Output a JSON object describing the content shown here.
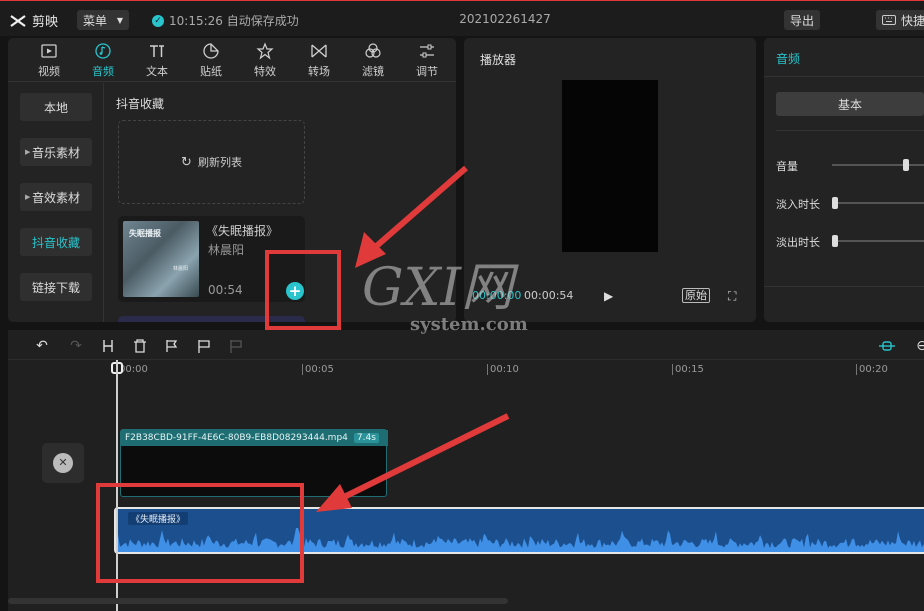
{
  "topbar": {
    "app_name": "剪映",
    "menu_label": "菜单",
    "save_status": "10:15:26 自动保存成功",
    "project_title": "202102261427",
    "export_label": "导出",
    "shortcut_label": "快捷"
  },
  "tabs": [
    {
      "label": "视频",
      "icon": "video-icon"
    },
    {
      "label": "音频",
      "icon": "audio-icon",
      "active": true
    },
    {
      "label": "文本",
      "icon": "text-icon"
    },
    {
      "label": "贴纸",
      "icon": "sticker-icon"
    },
    {
      "label": "特效",
      "icon": "effect-icon"
    },
    {
      "label": "转场",
      "icon": "transition-icon"
    },
    {
      "label": "滤镜",
      "icon": "filter-icon"
    },
    {
      "label": "调节",
      "icon": "adjust-icon"
    }
  ],
  "sidebar": {
    "items": [
      {
        "label": "本地"
      },
      {
        "label": "音乐素材"
      },
      {
        "label": "音效素材"
      },
      {
        "label": "抖音收藏",
        "active": true
      },
      {
        "label": "链接下载"
      }
    ]
  },
  "library": {
    "section_title": "抖音收藏",
    "refresh_label": "刷新列表",
    "card": {
      "title": "《失眠播报》",
      "artist": "林晨阳",
      "duration": "00:54",
      "thumb_title": "失眠播报",
      "thumb_label": "林晨阳"
    }
  },
  "player": {
    "title": "播放器",
    "current_time": "00:00:00",
    "total_time": "00:00:54",
    "ratio_label": "原始"
  },
  "inspector": {
    "title": "音频",
    "tab_basic": "基本",
    "volume_label": "音量",
    "fade_in_label": "淡入时长",
    "fade_out_label": "淡出时长",
    "volume_level": 0.68,
    "fade_in_level": 0,
    "fade_out_level": 0
  },
  "timeline": {
    "ticks": [
      "00:00",
      "00:05",
      "00:10",
      "00:15",
      "00:20"
    ],
    "video_clip": {
      "filename": "F2B38CBD-91FF-4E6C-80B9-EB8D08293444.mp4",
      "duration": "7.4s"
    },
    "audio_clip": {
      "label": "《失眠播报》"
    }
  },
  "watermark": {
    "brand": "GXI网",
    "domain": "system.com"
  },
  "colors": {
    "accent": "#29c4cc",
    "highlight": "#e03a3a",
    "audio_track": "#1b4f8e"
  }
}
